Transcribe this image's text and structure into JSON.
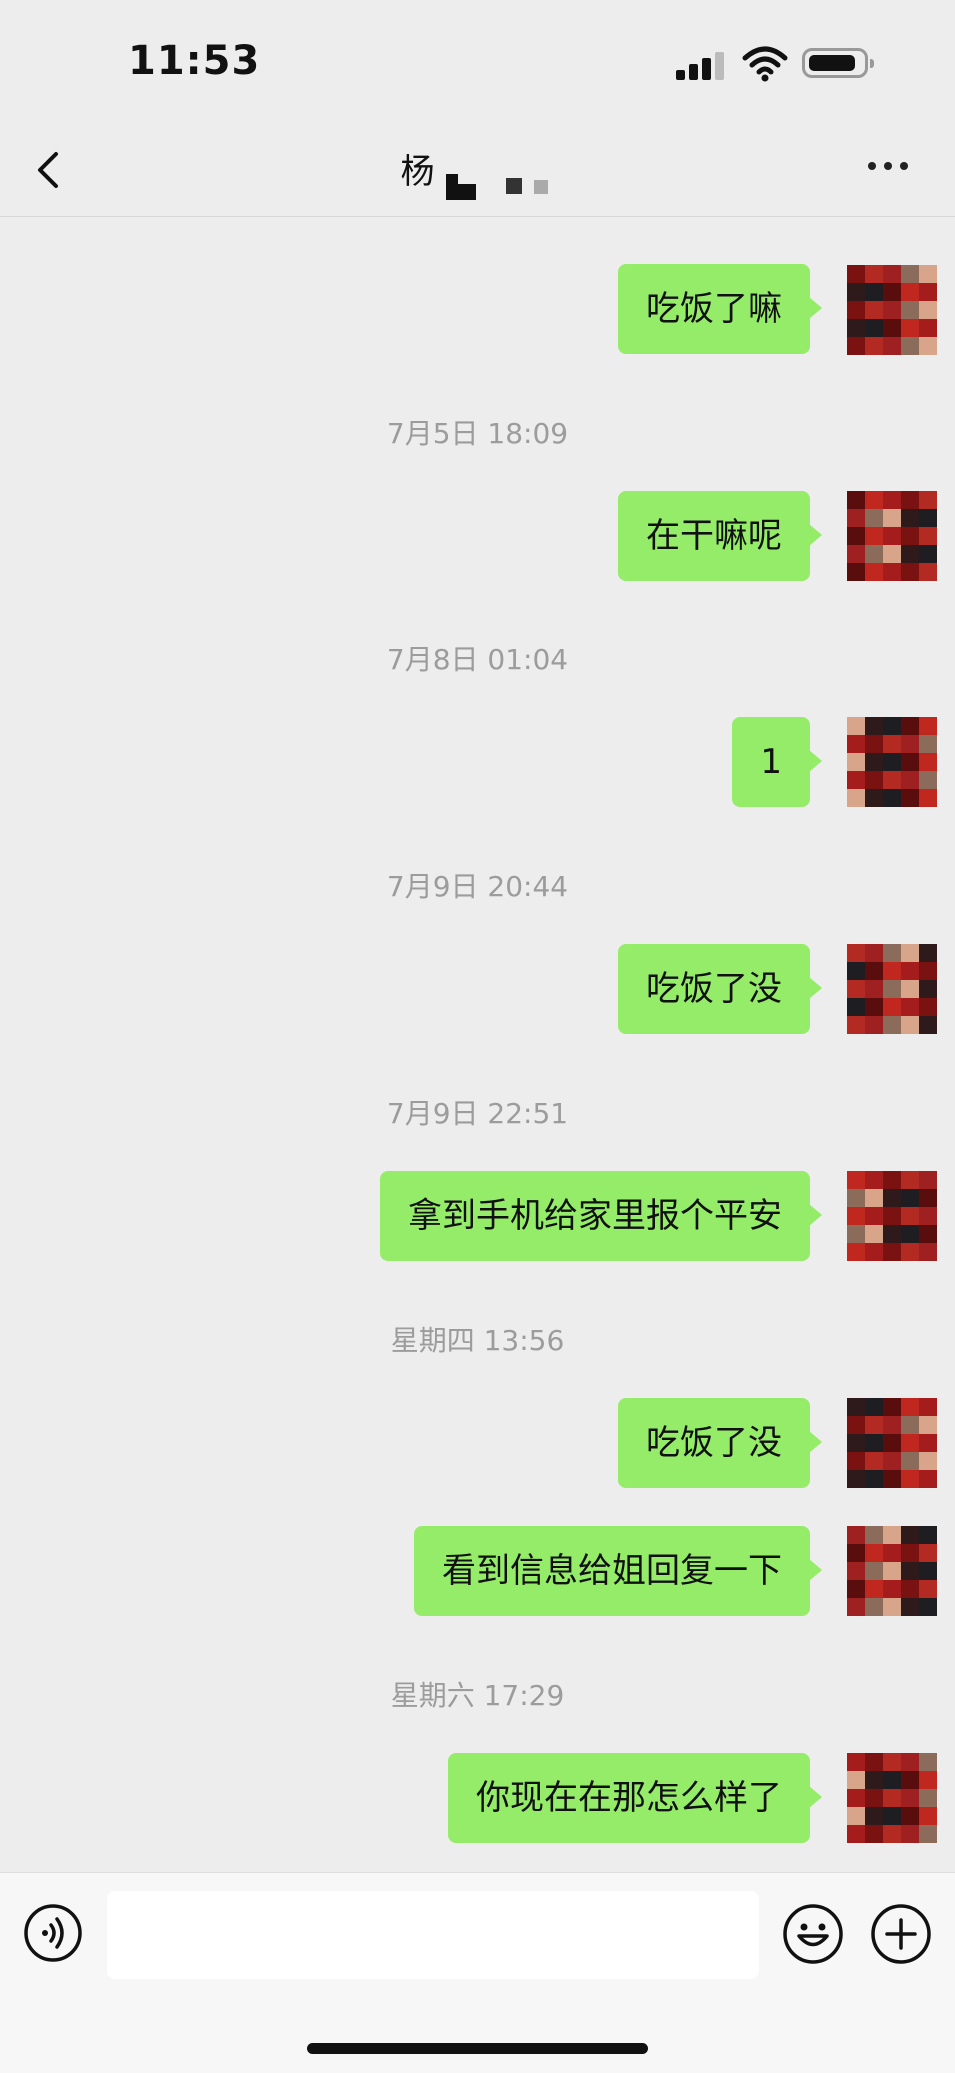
{
  "status_bar": {
    "time": "11:53"
  },
  "nav": {
    "title": "杨"
  },
  "messages": [
    {
      "type": "bubble",
      "text": "吃饭了嘛"
    },
    {
      "type": "time",
      "text": "7月5日 18:09"
    },
    {
      "type": "bubble",
      "text": "在干嘛呢"
    },
    {
      "type": "time",
      "text": "7月8日 01:04"
    },
    {
      "type": "bubble",
      "text": "1"
    },
    {
      "type": "time",
      "text": "7月9日 20:44"
    },
    {
      "type": "bubble",
      "text": "吃饭了没"
    },
    {
      "type": "time",
      "text": "7月9日 22:51"
    },
    {
      "type": "bubble",
      "text": "拿到手机给家里报个平安"
    },
    {
      "type": "time",
      "text": "星期四 13:56"
    },
    {
      "type": "bubble",
      "text": "吃饭了没"
    },
    {
      "type": "bubble",
      "text": "看到信息给姐回复一下"
    },
    {
      "type": "time",
      "text": "星期六 17:29"
    },
    {
      "type": "bubble",
      "text": "你现在在那怎么样了"
    }
  ],
  "input": {
    "value": ""
  },
  "colors": {
    "bubble": "#95ec69",
    "background": "#ededed",
    "timestamp": "#9c9c9c"
  },
  "icons": [
    "back-icon",
    "more-icon",
    "voice-icon",
    "emoji-icon",
    "plus-icon"
  ]
}
